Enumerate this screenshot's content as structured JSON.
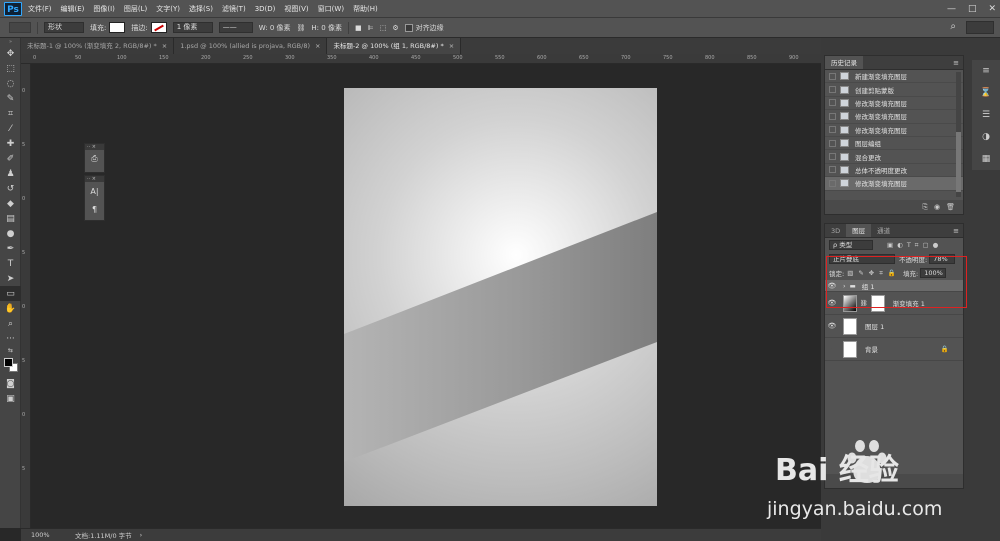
{
  "app": {
    "logo": "Ps",
    "menu": [
      "文件(F)",
      "编辑(E)",
      "图像(I)",
      "图层(L)",
      "文字(Y)",
      "选择(S)",
      "滤镜(T)",
      "3D(D)",
      "视图(V)",
      "窗口(W)",
      "帮助(H)"
    ],
    "window_controls": [
      "—",
      "□",
      "✕"
    ]
  },
  "options": {
    "mode": "形状",
    "fill_label": "填充:",
    "stroke_label": "描边:",
    "stroke_width": "1 像素",
    "w_label": "W:",
    "w_value": "0 像素",
    "h_label": "H:",
    "h_value": "0 像素",
    "align_edges": "对齐边缘"
  },
  "tabs": [
    {
      "label": "未标题-1 @ 100% (渐变填充 2, RGB/8#) *",
      "active": false
    },
    {
      "label": "1.psd @ 100% (allied is projava, RGB/8)",
      "active": false
    },
    {
      "label": "未标题-2 @ 100% (组 1, RGB/8#) *",
      "active": true
    }
  ],
  "ruler_top": [
    "0",
    "50",
    "100",
    "150",
    "200",
    "250",
    "300",
    "350",
    "400",
    "450",
    "500",
    "550",
    "600",
    "650",
    "700",
    "750",
    "800",
    "850",
    "900"
  ],
  "ruler_left": [
    "0",
    "5",
    "0",
    "5",
    "0",
    "5",
    "0",
    "5"
  ],
  "mini_panels": {
    "panel1_icon": "⎙",
    "panel2_icon_a": "A|",
    "panel2_icon_b": "¶"
  },
  "status": {
    "zoom": "100%",
    "doc": "文档:1.11M/0 字节"
  },
  "history": {
    "title": "历史记录",
    "items": [
      "新建渐变填充图层",
      "创建剪贴蒙版",
      "修改渐变填充图层",
      "修改渐变填充图层",
      "修改渐变填充图层",
      "图层编组",
      "混合更改",
      "总体不透明度更改",
      "修改渐变填充图层"
    ],
    "active_index": 8
  },
  "layers": {
    "tabs": [
      "3D",
      "图层",
      "通道"
    ],
    "kind_label": "ρ 类型",
    "blend_mode": "正片叠底",
    "opacity_label": "不透明度:",
    "opacity_value": "78%",
    "lock_label": "锁定:",
    "fill_label": "填充:",
    "fill_value": "100%",
    "items": [
      {
        "name": "组 1",
        "type": "group"
      },
      {
        "name": "渐变填充 1",
        "type": "gradient"
      },
      {
        "name": "图层 1",
        "type": "layer"
      },
      {
        "name": "背景",
        "type": "background"
      }
    ]
  },
  "watermark": {
    "text": "jingyan.baidu.com",
    "brand": "Bai 经验"
  },
  "colors": {
    "highlight": "#d22222",
    "accent": "#31a8ff"
  }
}
